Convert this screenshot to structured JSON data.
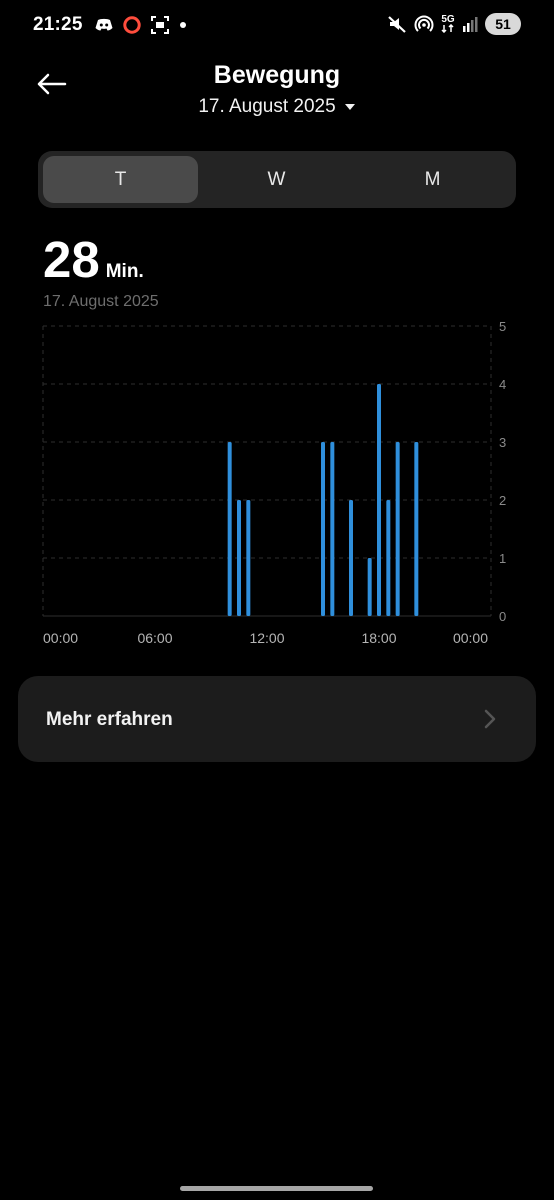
{
  "status": {
    "time": "21:25",
    "network": "5G",
    "battery": "51",
    "icons": [
      "discord-icon",
      "record-icon",
      "screenshot-icon",
      "dot-icon",
      "mute-icon",
      "hotspot-icon",
      "5g-icon",
      "signal-icon"
    ]
  },
  "header": {
    "title": "Bewegung",
    "date": "17. August 2025"
  },
  "tabs": [
    {
      "label": "T",
      "active": true
    },
    {
      "label": "W",
      "active": false
    },
    {
      "label": "M",
      "active": false
    }
  ],
  "summary": {
    "value": "28",
    "unit": "Min.",
    "date": "17. August 2025"
  },
  "chart_data": {
    "type": "bar",
    "color": "#2f8fdc",
    "x_labels": [
      "00:00",
      "06:00",
      "12:00",
      "18:00",
      "00:00"
    ],
    "y_ticks": [
      0,
      1,
      2,
      3,
      4,
      5
    ],
    "ylim": [
      0,
      5
    ],
    "xlim_hours": [
      0,
      24
    ],
    "grid": true,
    "points": [
      {
        "hour": 10.0,
        "value": 3
      },
      {
        "hour": 10.5,
        "value": 2
      },
      {
        "hour": 11.0,
        "value": 2
      },
      {
        "hour": 15.0,
        "value": 3
      },
      {
        "hour": 15.5,
        "value": 3
      },
      {
        "hour": 16.5,
        "value": 2
      },
      {
        "hour": 17.5,
        "value": 1
      },
      {
        "hour": 18.0,
        "value": 4
      },
      {
        "hour": 18.5,
        "value": 2
      },
      {
        "hour": 19.0,
        "value": 3
      },
      {
        "hour": 20.0,
        "value": 3
      }
    ]
  },
  "more": {
    "label": "Mehr erfahren"
  }
}
